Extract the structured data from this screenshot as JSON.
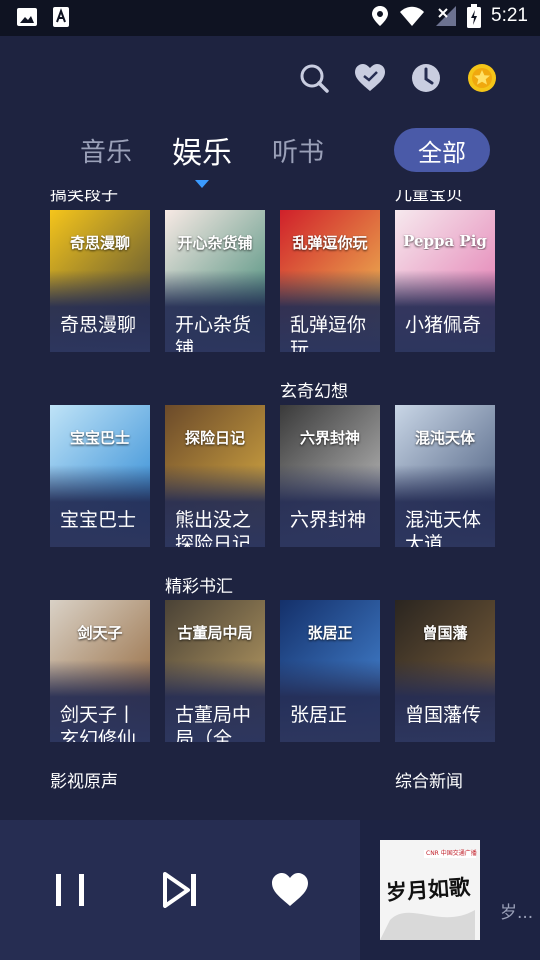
{
  "status_bar": {
    "time": "5:21",
    "icons": [
      "image-icon",
      "font-icon",
      "location-icon",
      "wifi-icon",
      "signal-icon",
      "battery-icon"
    ]
  },
  "header_icons": [
    "search-icon",
    "favorite-icon",
    "history-icon",
    "coin-icon"
  ],
  "tabs": [
    {
      "label": "音乐",
      "active": false
    },
    {
      "label": "娱乐",
      "active": true
    },
    {
      "label": "听书",
      "active": false
    }
  ],
  "all_button": "全部",
  "sections": {
    "funny": "搞笑段子",
    "kids": "儿童宝贝",
    "fantasy": "玄奇幻想",
    "books": "精彩书汇",
    "film_sound": "影视原声",
    "news": "综合新闻"
  },
  "cards": [
    {
      "title": "奇思漫聊",
      "title2": "",
      "art_text": "奇思漫聊",
      "colors": [
        "#f5c51b",
        "#3b3b3b"
      ]
    },
    {
      "title": "开心杂货",
      "title2": "铺",
      "art_text": "开心杂货铺",
      "colors": [
        "#f7e9e4",
        "#2e7f6a"
      ]
    },
    {
      "title": "乱弹逗你",
      "title2": "玩",
      "art_text": "乱弹逗你玩",
      "colors": [
        "#d0202a",
        "#f3d35a"
      ]
    },
    {
      "title": "小猪佩奇",
      "title2": "",
      "art_text": "Peppa Pig",
      "colors": [
        "#f6e9ee",
        "#e06aa8"
      ]
    },
    {
      "title": "宝宝巴士",
      "title2": "",
      "art_text": "宝宝巴士",
      "colors": [
        "#bfe3f7",
        "#1e7fd0"
      ]
    },
    {
      "title": "熊出没之",
      "title2": "探险日记",
      "art_text": "探险日记",
      "colors": [
        "#6b4a2a",
        "#e6b846"
      ]
    },
    {
      "title": "六界封神",
      "title2": "",
      "art_text": "六界封神",
      "colors": [
        "#3a3a3a",
        "#cfcfcf"
      ]
    },
    {
      "title": "混沌天体",
      "title2": "大道",
      "art_text": "混沌天体",
      "colors": [
        "#c9d6e6",
        "#394c70"
      ]
    },
    {
      "title": "剑天子丨",
      "title2": "玄幻修仙",
      "art_text": "剑天子",
      "colors": [
        "#d9d1c6",
        "#8a5a2a"
      ]
    },
    {
      "title": "古董局中",
      "title2": "局（全",
      "art_text": "古董局中局",
      "colors": [
        "#4a4236",
        "#c8a96a"
      ]
    },
    {
      "title": "张居正",
      "title2": "",
      "art_text": "张居正",
      "colors": [
        "#14306a",
        "#4b8fe0"
      ]
    },
    {
      "title": "曾国藩传",
      "title2": "",
      "art_text": "曾国藩",
      "colors": [
        "#2a2520",
        "#8a6a40"
      ]
    }
  ],
  "player": {
    "now_playing_title": "岁...",
    "cover_text": "岁月如歌",
    "cover_badge": "CNR 中国交通广播"
  }
}
